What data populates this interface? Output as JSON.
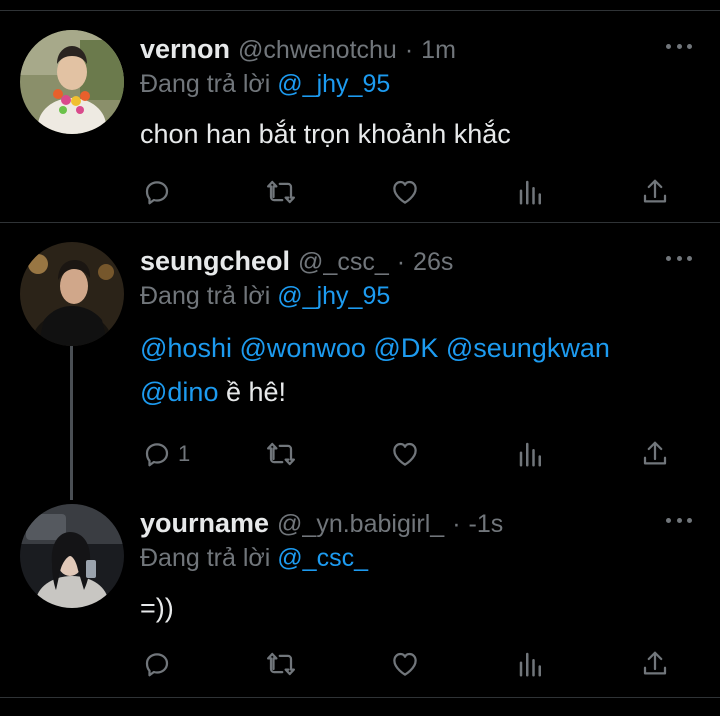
{
  "tweets": [
    {
      "name": "vernon",
      "handle": "@chwenotchu",
      "sep": "·",
      "time": "1m",
      "replying_prefix": "Đang trả lời",
      "replying_to": "@_jhy_95",
      "text": "chon han bắt trọn khoảnh khắc",
      "reply_count": ""
    },
    {
      "name": "seungcheol",
      "handle": "@_csc_",
      "sep": "·",
      "time": "26s",
      "replying_prefix": "Đang trả lời",
      "replying_to": "@_jhy_95",
      "text_line1": "@hoshi @wonwoo @DK @seungkwan",
      "text_line2_mention": "@dino",
      "text_line2_rest": " ề hê!",
      "reply_count": "1"
    },
    {
      "name": "yourname",
      "handle": "@_yn.babigirl_",
      "sep": "·",
      "time": "-1s",
      "replying_prefix": "Đang trả lời",
      "replying_to": "@_csc_",
      "text": "=))",
      "reply_count": ""
    }
  ],
  "icons": [
    "reply-icon",
    "retweet-icon",
    "like-icon",
    "views-icon",
    "share-icon",
    "more-icon"
  ],
  "colors": {
    "background": "#000000",
    "text": "#e7e9ea",
    "muted": "#71767b",
    "link": "#1d9bf0",
    "divider": "#2f3336"
  }
}
